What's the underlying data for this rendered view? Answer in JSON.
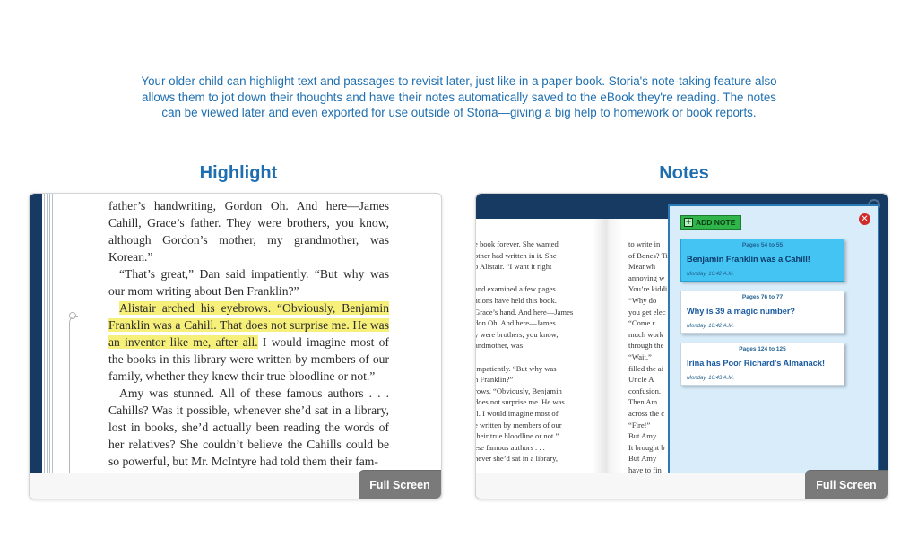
{
  "intro": {
    "text": "Your older child can highlight text and passages to revisit later, just like in a paper book. Storia's note-taking feature also allows them to jot down their thoughts and have their notes automatically saved to the eBook they're reading. The notes can be viewed later and even exported for use outside of Storia—giving a big help to homework or book reports."
  },
  "highlight_panel": {
    "title": "Highlight",
    "fullscreen_label": "Full Screen",
    "paragraphs": [
      {
        "text": "father’s handwriting, Gordon Oh. And here—James Cahill, Grace’s father. They were brothers, you know, although Gordon’s mother, my grandmother, was Korean.”"
      },
      {
        "text": "“That’s great,” Dan said impatiently. “But why was our mom writing about Ben Franklin?”"
      },
      {
        "highlighted": "Alistair arched his eyebrows. “Obviously, Benjamin Franklin was a Cahill. That does not surprise me. He was an inventor like me, after all.",
        "rest": " I would imagine most of the books in this library were written by members of our family, whether they knew their true bloodline or not.”"
      },
      {
        "text": "Amy was stunned. All of these famous authors . . . Cahills? Was it possible, whenever she’d sat in a library, lost in books, she’d actually been reading the words of her relatives? She couldn’t believe the Cahills could be so powerful, but Mr. McIntyre had told them their fam-"
      }
    ]
  },
  "notes_panel": {
    "title": "Notes",
    "fullscreen_label": "Full Screen",
    "add_note_label": "ADD NOTE",
    "book_left_lines": [
      "e book forever. She wanted",
      "other had written in it. She",
      "o Alistair. “I want it right",
      "",
      "and examined a few pages.",
      "ations have held this book.",
      "Grace’s hand. And here—James",
      "don Oh. And here—James",
      "y were brothers, you know,",
      "andmother, was",
      "",
      "impatiently. “But why was",
      "n Franklin?”",
      "rows. “Obviously, Benjamin",
      "does not surprise me. He was",
      "ll. I would imagine most of",
      "e written by members of our",
      "their true bloodline or not.”",
      "ese famous authors . . .",
      "never she’d sat in a library,"
    ],
    "book_right_lines": [
      "to write in",
      "of Bones? Ti",
      "Meanwh",
      "annoying w",
      "You’re kiddi",
      "“Why do",
      "you get elec",
      "“Come r",
      "much work",
      "through the",
      "“Wait.”",
      "filled the ai",
      "Uncle A",
      "confusion.",
      "Then Am",
      "across the c",
      "“Fire!”",
      "But Amy",
      "It brought b",
      "But Amy",
      "have to fin"
    ],
    "notes": [
      {
        "pages": "Pages 54 to 55",
        "title": "Benjamin Franklin was a Cahill!",
        "time": "Monday, 10:42 A.M."
      },
      {
        "pages": "Pages 76 to 77",
        "title": "Why is 39 a magic number?",
        "time": "Monday, 10:42 A.M."
      },
      {
        "pages": "Pages 124 to 125",
        "title": "Irina has Poor Richard's Almanack!",
        "time": "Monday, 10:43 A.M."
      }
    ]
  },
  "colors": {
    "accent_blue": "#1f6fb0",
    "navy": "#173a62",
    "highlight_yellow": "#f6f07a",
    "note_active": "#44c4f2",
    "add_note_green": "#2fb54a"
  }
}
